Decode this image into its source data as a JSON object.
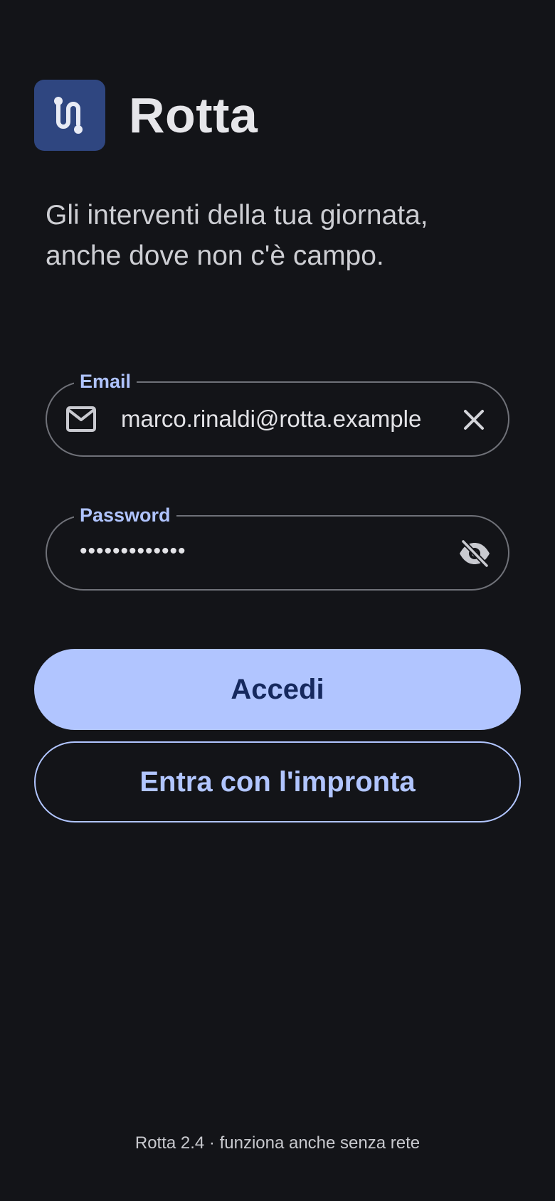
{
  "app": {
    "name": "Rotta",
    "logo_icon": "route-icon",
    "tagline_line1": "Gli interventi della tua giornata,",
    "tagline_line2": "anche dove non c'è campo."
  },
  "form": {
    "email": {
      "label": "Email",
      "value": "marco.rinaldi@rotta.example",
      "leading_icon": "mail-icon",
      "trailing_icon": "clear-icon"
    },
    "password": {
      "label": "Password",
      "masked_value": "•••••••••••••",
      "trailing_icon": "visibility-off-icon"
    }
  },
  "actions": {
    "login_label": "Accedi",
    "fingerprint_label": "Entra con l'impronta"
  },
  "footer": {
    "text": "Rotta 2.4 · funziona anche senza rete"
  },
  "colors": {
    "background": "#131418",
    "accent": "#b1c5ff",
    "logo_background": "#2f4680",
    "primary_button_text": "#16295e"
  }
}
